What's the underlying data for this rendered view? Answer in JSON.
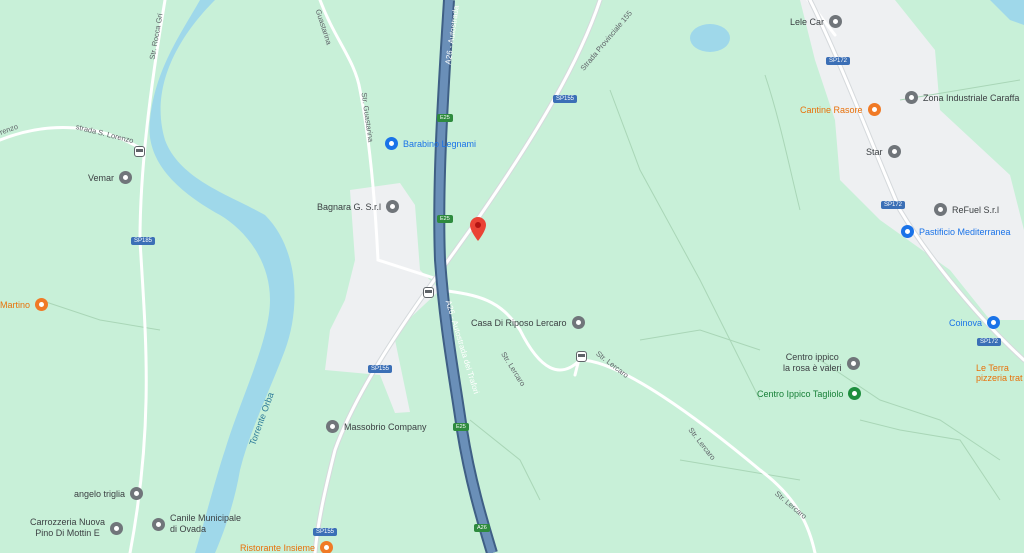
{
  "pois": [
    {
      "id": "lele-car",
      "label": "Lele Car",
      "style": "gray",
      "side": "left"
    },
    {
      "id": "cantine-rasore",
      "label": "Cantine Rasore",
      "style": "orange",
      "side": "left"
    },
    {
      "id": "zona-industriale",
      "label": "Zona Industriale Caraffa",
      "style": "gray",
      "side": "right"
    },
    {
      "id": "star",
      "label": "Star",
      "style": "gray",
      "side": "left"
    },
    {
      "id": "refuel",
      "label": "ReFuel S.r.l",
      "style": "gray",
      "side": "right"
    },
    {
      "id": "pastificio",
      "label": "Pastificio Mediterranea",
      "style": "blue",
      "side": "right"
    },
    {
      "id": "coinova",
      "label": "Coinova",
      "style": "blue",
      "side": "left"
    },
    {
      "id": "le-terra",
      "label": "Le Terra\npizzeria trat",
      "style": "orange",
      "side": "left"
    },
    {
      "id": "centro-ippico-rosa",
      "label": "Centro ippico\nla rosa è valeri",
      "style": "gray",
      "side": "left"
    },
    {
      "id": "centro-ippico-tagliolo",
      "label": "Centro Ippico Tagliolo",
      "style": "green",
      "side": "left"
    },
    {
      "id": "barabino",
      "label": "Barabino Legnami",
      "style": "blue",
      "side": "right"
    },
    {
      "id": "bagnara",
      "label": "Bagnara G. S.r.l",
      "style": "gray",
      "side": "left"
    },
    {
      "id": "casa-riposo",
      "label": "Casa Di Riposo Lercaro",
      "style": "gray",
      "side": "left"
    },
    {
      "id": "massobrio",
      "label": "Massobrio Company",
      "style": "gray",
      "side": "right"
    },
    {
      "id": "vemar",
      "label": "Vemar",
      "style": "gray",
      "side": "left"
    },
    {
      "id": "martino",
      "label": "Martino",
      "style": "orange",
      "side": "left"
    },
    {
      "id": "angelo-triglia",
      "label": "angelo triglia",
      "style": "gray",
      "side": "left"
    },
    {
      "id": "carrozzeria",
      "label": "Carrozzeria Nuova\nPino Di Mottin E",
      "style": "gray",
      "side": "left"
    },
    {
      "id": "canile",
      "label": "Canile Municipale\ndi Ovada",
      "style": "gray",
      "side": "right"
    },
    {
      "id": "ristorante",
      "label": "Ristorante Insieme",
      "style": "orange",
      "side": "left"
    }
  ],
  "road_labels": [
    {
      "id": "str-rocca-grimalda",
      "text": "Str. Rocca Gri"
    },
    {
      "id": "a26-top",
      "text": "A26 - Autostrada"
    },
    {
      "id": "strada-provinciale-155",
      "text": "Strada Provinciale 155"
    },
    {
      "id": "str-guastarina-1",
      "text": "Guastarina"
    },
    {
      "id": "str-guastarina-2",
      "text": "Str. Guastarina"
    },
    {
      "id": "strada-s-lorenzo",
      "text": "strada S. Lorenzo"
    },
    {
      "id": "renzo",
      "text": "renzo"
    },
    {
      "id": "a26-mid",
      "text": "A26 - Autostrada dei Trafori"
    },
    {
      "id": "str-lercaro-1",
      "text": "Str. Lercaro"
    },
    {
      "id": "str-lercaro-2",
      "text": "Str. Lercaro"
    },
    {
      "id": "str-lercaro-3",
      "text": "Str. Lercaro"
    },
    {
      "id": "str-lercaro-4",
      "text": "Str. Lercaro"
    }
  ],
  "shields": [
    {
      "id": "sp172-a",
      "text": "SP172",
      "color": "blue"
    },
    {
      "id": "sp172-b",
      "text": "SP172",
      "color": "blue"
    },
    {
      "id": "sp172-c",
      "text": "SP172",
      "color": "blue"
    },
    {
      "id": "sp155-a",
      "text": "SP155",
      "color": "blue"
    },
    {
      "id": "sp155-b",
      "text": "SP155",
      "color": "blue"
    },
    {
      "id": "sp155-c",
      "text": "SP155",
      "color": "blue"
    },
    {
      "id": "sp185",
      "text": "SP185",
      "color": "blue"
    },
    {
      "id": "e25-a",
      "text": "E25",
      "color": "green"
    },
    {
      "id": "e25-b",
      "text": "E25",
      "color": "green"
    },
    {
      "id": "e25-c",
      "text": "E25",
      "color": "green"
    },
    {
      "id": "a26-shield",
      "text": "A26",
      "color": "green"
    }
  ],
  "water_label": "Torrente Orba",
  "colors": {
    "land": "#c8f0d8",
    "urban": "#eef0f2",
    "water": "#9fd8ea",
    "motorway": "#5b7fa5",
    "road": "#ffffff",
    "marker": "#ea4335"
  }
}
